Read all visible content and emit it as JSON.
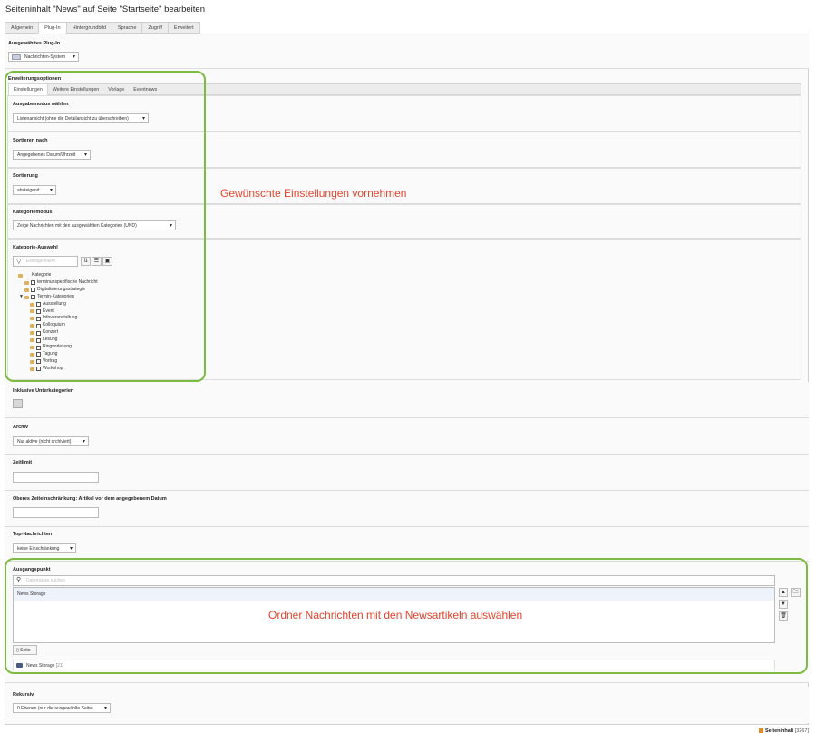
{
  "page_title": "Seiteninhalt \"News\" auf Seite \"Startseite\" bearbeiten",
  "tabs": [
    "Allgemein",
    "Plug-In",
    "Hintergrundbild",
    "Sprache",
    "Zugriff",
    "Erweitert"
  ],
  "active_tab": "Plug-In",
  "plugin": {
    "label": "Ausgewähltes Plug-In",
    "value": "Nachrichten-System"
  },
  "extension": {
    "label": "Erweiterungsoptionen",
    "subtabs": [
      "Einstellungen",
      "Weitere Einstellungen",
      "Vorlage",
      "Eventnews"
    ]
  },
  "fields": {
    "ausgabemodus": {
      "label": "Ausgabemodus wählen",
      "value": "Listenansicht (ohne die Detailansicht zu überschreiben)"
    },
    "sortieren": {
      "label": "Sortieren nach",
      "value": "Angegebenes Datum/Uhrzeit"
    },
    "sortierung": {
      "label": "Sortierung",
      "value": "absteigend"
    },
    "kategoriemodus": {
      "label": "Kategoriemodus",
      "value": "Zeige Nachrichten mit den ausgewählten Kategorien (UND)"
    },
    "kategorie_auswahl": {
      "label": "Kategorie-Auswahl",
      "filter_placeholder": "Einträge filtern"
    },
    "unterkategorien": {
      "label": "Inklusive Unterkategorien"
    },
    "archiv": {
      "label": "Archiv",
      "value": "Nur aktive (nicht archiviert)"
    },
    "zeitlimit": {
      "label": "Zeitlimit"
    },
    "oberes": {
      "label": "Oberes Zeiteinschränkung: Artikel vor dem angegebenem Datum"
    },
    "top": {
      "label": "Top-Nachrichten",
      "value": "keine Einschränkung"
    },
    "ausgangspunkt": {
      "label": "Ausgangspunkt",
      "search_placeholder": "Datensätze suchen",
      "selected": "News Storage",
      "page_button": "Seite",
      "tree_item": "News Storage",
      "tree_item_id": "[21]"
    },
    "rekursiv": {
      "label": "Rekursiv",
      "value": "0 Ebenen (nur die ausgewählte Seite)"
    }
  },
  "tree": {
    "root": "Kategorie",
    "top_items": [
      "terminunspezifische Nachricht",
      "Digitalisierungsstrategie"
    ],
    "group": "Termin-Kategorien",
    "children": [
      "Ausstellung",
      "Event",
      "Infoveranstaltung",
      "Kolloquium",
      "Konzert",
      "Lesung",
      "Ringvorlesung",
      "Tagung",
      "Vortrag",
      "Workshop"
    ]
  },
  "annotations": {
    "note1": "Gewünschte Einstellungen vornehmen",
    "note2": "Ordner Nachrichten mit den Newsartikeln auswählen"
  },
  "footer": {
    "label": "Seiteninhalt",
    "id": "[3267]"
  },
  "colors": {
    "annotation_border": "#7dbb42",
    "annotation_text": "#e5442d"
  }
}
